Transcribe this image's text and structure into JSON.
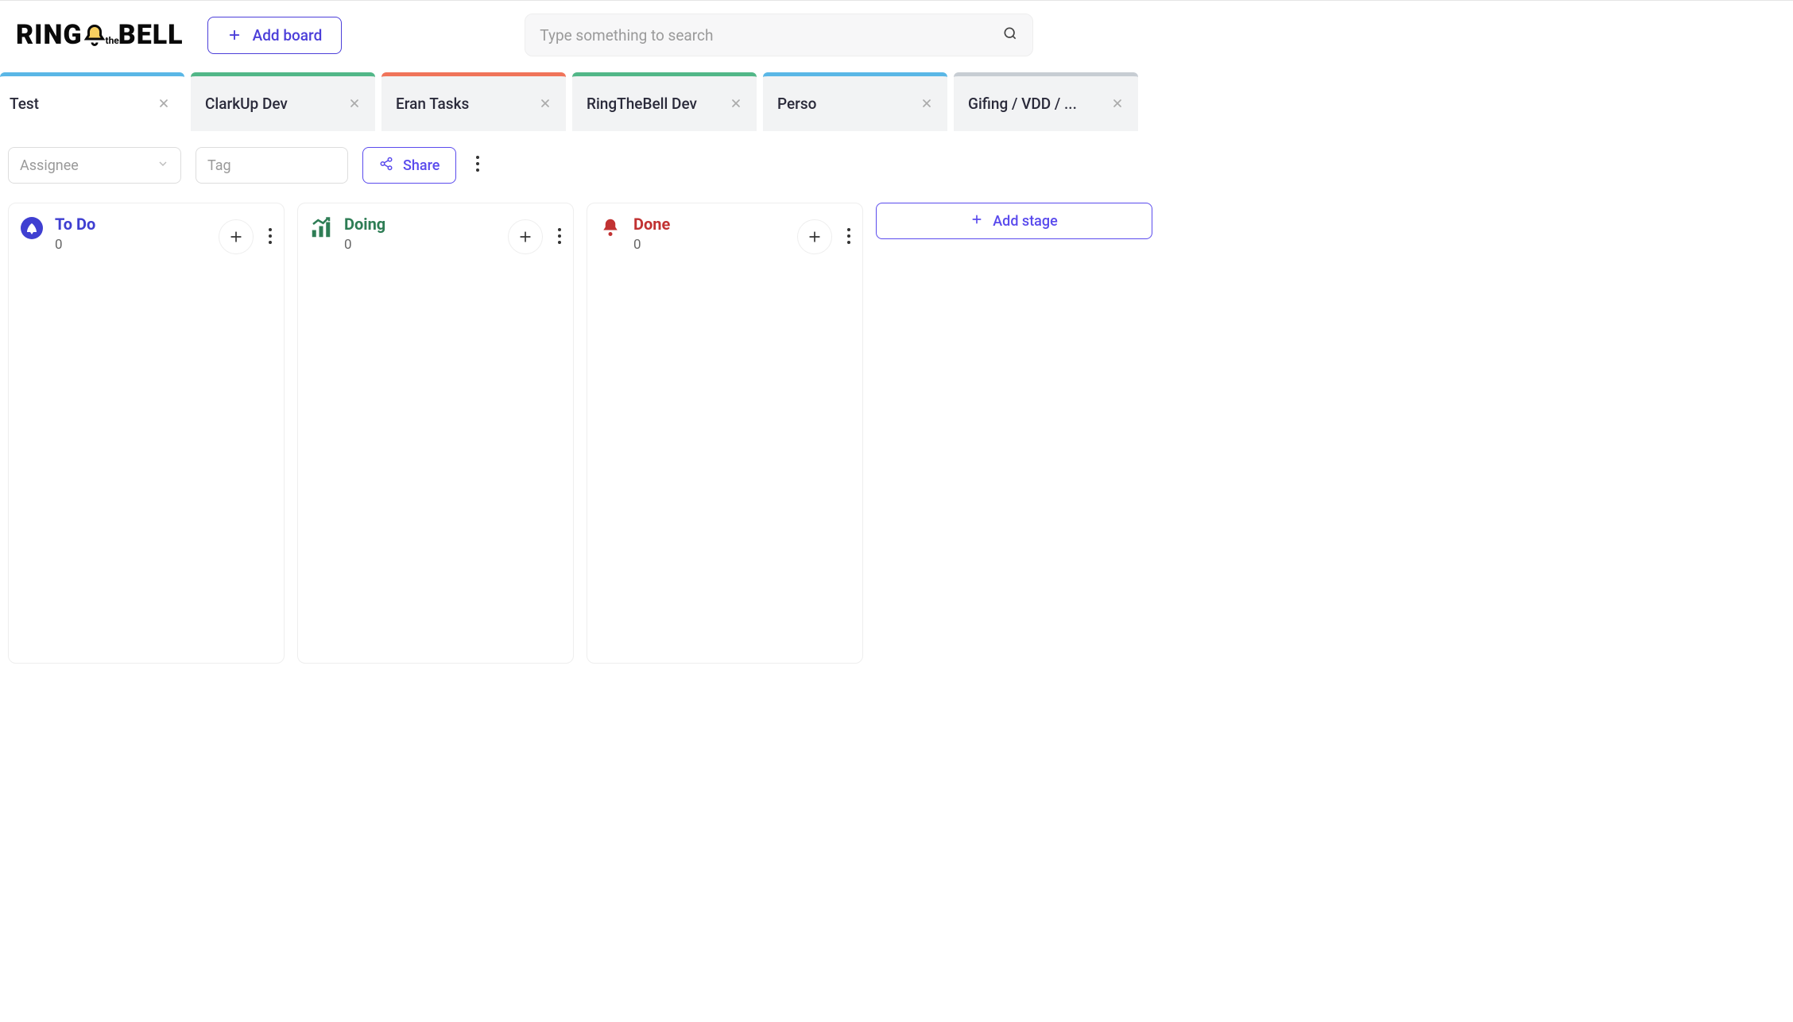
{
  "header": {
    "logo_left": "RING",
    "logo_the": "the",
    "logo_right": "BELL",
    "add_board_label": "Add board",
    "search_placeholder": "Type something to search"
  },
  "tabs": [
    {
      "label": "Test",
      "accent": "#5ab7e6",
      "active": true
    },
    {
      "label": "ClarkUp Dev",
      "accent": "#52b788",
      "active": false
    },
    {
      "label": "Eran Tasks",
      "accent": "#f0745a",
      "active": false
    },
    {
      "label": "RingTheBell Dev",
      "accent": "#52b788",
      "active": false
    },
    {
      "label": "Perso",
      "accent": "#5ab7e6",
      "active": false
    },
    {
      "label": "Gifing / VDD / ...",
      "accent": "#c7cdd3",
      "active": false
    }
  ],
  "toolbar": {
    "assignee_placeholder": "Assignee",
    "tag_placeholder": "Tag",
    "share_label": "Share"
  },
  "stages": [
    {
      "title": "To Do",
      "count": "0",
      "title_color": "#3f3fd1",
      "icon": "rocket"
    },
    {
      "title": "Doing",
      "count": "0",
      "title_color": "#2e7d55",
      "icon": "chart"
    },
    {
      "title": "Done",
      "count": "0",
      "title_color": "#c13232",
      "icon": "bell"
    }
  ],
  "add_stage_label": "Add stage"
}
